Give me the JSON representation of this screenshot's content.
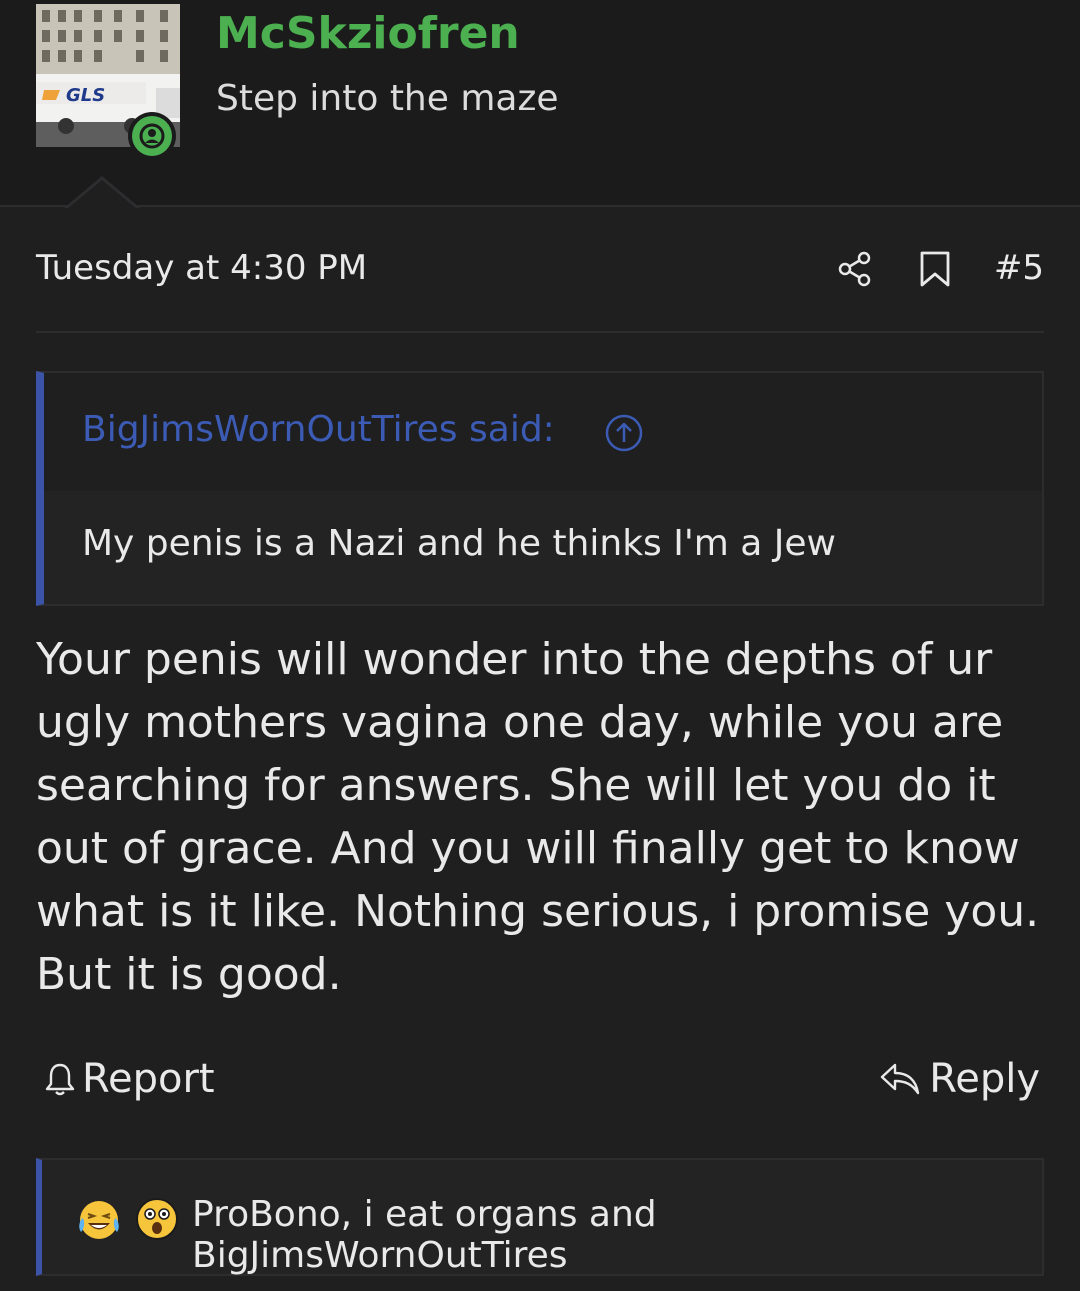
{
  "author": {
    "username": "McSkziofren",
    "title": "Step into the maze",
    "avatar_icon": "gls-van-photo",
    "avatar_text": "GLS",
    "online_status": "online"
  },
  "post": {
    "date": "Tuesday at 4:30 PM",
    "number": "#5",
    "share_icon": "share-icon",
    "bookmark_icon": "bookmark-icon"
  },
  "quote": {
    "author_label": "BigJimsWornOutTires said:",
    "body": "My penis is a Nazi and he thinks I'm a Jew"
  },
  "body": "Your penis will wonder into the depths of ur ugly mothers vagina one day, while you are searching for answers. She will let you do it out of grace. And you will finally get to know what is it like. Nothing serious, i promise you. But it is good.",
  "actions": {
    "report_label": "Report",
    "reply_label": "Reply"
  },
  "reactions": {
    "emojis": [
      "laughing-crying-emoji",
      "astonished-emoji"
    ],
    "users_text": "ProBono, i eat organs and BigJimsWornOutTires"
  },
  "colors": {
    "username": "#4caf50",
    "quote_accent": "#3c54a8",
    "quote_author": "#3b5bb5",
    "background": "#1f1f20"
  }
}
